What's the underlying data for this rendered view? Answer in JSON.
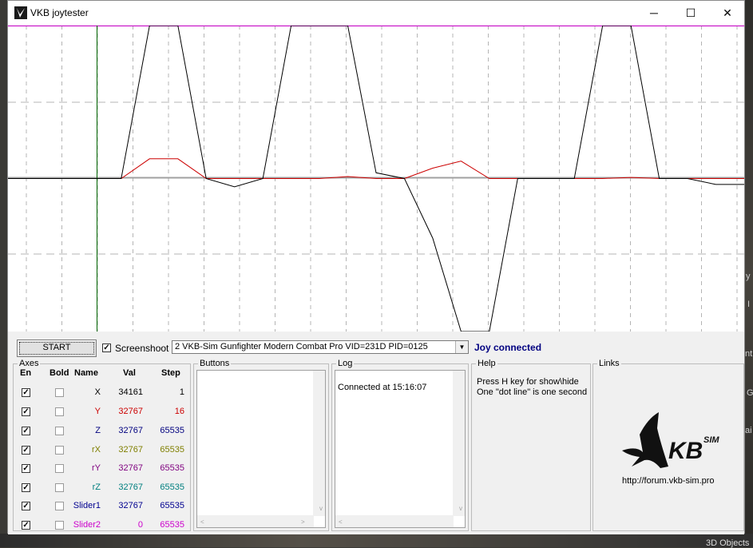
{
  "window": {
    "title": "VKB joytester",
    "minimize_glyph": "─",
    "maximize_glyph": "☐",
    "close_glyph": "✕"
  },
  "icons": {
    "app": "vkb-bird-icon",
    "minimize": "minimize-icon",
    "maximize": "maximize-icon",
    "close": "close-icon"
  },
  "controls": {
    "start_label": "START",
    "screenshot_label": "Screenshoot",
    "screenshot_checked": true,
    "device_selected": "2  VKB-Sim Gunfighter Modern Combat Pro  VID=231D PID=0125",
    "status": "Joy connected"
  },
  "axes": {
    "group_label": "Axes",
    "headers": {
      "en": "En",
      "bold": "Bold",
      "name": "Name",
      "val": "Val",
      "step": "Step"
    },
    "rows": [
      {
        "name": "X",
        "val": "34161",
        "step": "1",
        "en": true,
        "bold": false,
        "color": "#000000"
      },
      {
        "name": "Y",
        "val": "32767",
        "step": "16",
        "en": true,
        "bold": false,
        "color": "#cc0000"
      },
      {
        "name": "Z",
        "val": "32767",
        "step": "65535",
        "en": true,
        "bold": false,
        "color": "#00007f"
      },
      {
        "name": "rX",
        "val": "32767",
        "step": "65535",
        "en": true,
        "bold": false,
        "color": "#7f7f00"
      },
      {
        "name": "rY",
        "val": "32767",
        "step": "65535",
        "en": true,
        "bold": false,
        "color": "#7f007f"
      },
      {
        "name": "rZ",
        "val": "32767",
        "step": "65535",
        "en": true,
        "bold": false,
        "color": "#007f7f"
      },
      {
        "name": "Slider1",
        "val": "32767",
        "step": "65535",
        "en": true,
        "bold": false,
        "color": "#00008f"
      },
      {
        "name": "Slider2",
        "val": "0",
        "step": "65535",
        "en": true,
        "bold": false,
        "color": "#cc00cc"
      }
    ]
  },
  "buttons_group": {
    "label": "Buttons"
  },
  "log": {
    "label": "Log",
    "lines": [
      "Connected at 15:16:07"
    ]
  },
  "help": {
    "label": "Help",
    "lines": [
      "Press H key for show\\hide",
      "One \"dot line\" is one second"
    ]
  },
  "links": {
    "label": "Links",
    "logo_text": "KB",
    "logo_sup": "SIM",
    "url": "http://forum.vkb-sim.pro"
  },
  "background": {
    "taskbar_label": "3D Objects",
    "side_chars": [
      "y",
      "I",
      "nt",
      "G",
      "ai"
    ]
  },
  "colors": {
    "trace_x": "#000000",
    "trace_y": "#cc0000",
    "top_line": "#cc00cc",
    "cursor_line": "#006400",
    "center_line": "#a0a0a0",
    "grid": "#b4b4b4",
    "status": "#000080"
  },
  "chart_data": {
    "type": "line",
    "title": "",
    "xlabel": "",
    "ylabel": "",
    "ylim": [
      0,
      65535
    ],
    "grid": true,
    "series": [
      {
        "color": "#000000",
        "values": [
          32767,
          32767,
          32767,
          32767,
          32767,
          65535,
          65535,
          32767,
          31000,
          32767,
          65535,
          65535,
          65535,
          34000,
          32767,
          20000,
          0,
          0,
          32767,
          32767,
          32767,
          65535,
          65535,
          32767,
          32767,
          31500,
          31500
        ]
      },
      {
        "color": "#cc0000",
        "values": [
          32767,
          32767,
          32767,
          32767,
          32767,
          37000,
          37000,
          32767,
          32767,
          32767,
          32767,
          32767,
          33200,
          32767,
          32767,
          35000,
          36500,
          32767,
          32767,
          32767,
          32767,
          32767,
          33000,
          32767,
          32767,
          32767,
          32767
        ]
      }
    ]
  }
}
